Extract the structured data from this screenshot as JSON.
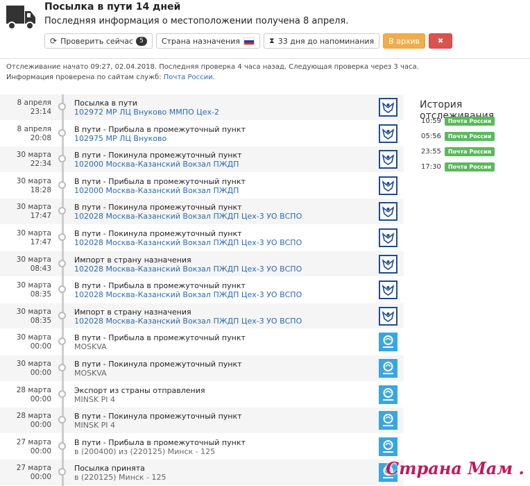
{
  "header": {
    "title": "Посылка в пути 14 дней",
    "subtitle": "Последняя информация о местоположении получена 8 апреля.",
    "buttons": {
      "check_now": "Проверить сейчас",
      "check_count": "5",
      "destination": "Страна назначения",
      "reminder": "33 дня до напоминания",
      "archive": "В архив",
      "delete": "✖"
    }
  },
  "info": {
    "line1": "Отслеживание начато 09:27, 02.04.2018. Последняя проверка 4 часа назад. Следующая проверка через 3 часа.",
    "line2_prefix": "Информация проверена по сайтам служб: ",
    "line2_link": "Почта России",
    "line2_suffix": "."
  },
  "events": [
    {
      "date": "8 апреля",
      "time": "23:14",
      "status": "Посылка в пути",
      "location": "102972 МР ЛЦ Внуково ММПО Цех-2",
      "service": "rp"
    },
    {
      "date": "8 апреля",
      "time": "20:08",
      "status": "В пути - Прибыла в промежуточный пункт",
      "location": "102975 МР ЛЦ Внуково",
      "service": "rp"
    },
    {
      "date": "30 марта",
      "time": "22:34",
      "status": "В пути - Покинула промежуточный пункт",
      "location": "102000 Москва-Казанский Вокзал ПЖДП",
      "service": "rp"
    },
    {
      "date": "30 марта",
      "time": "18:28",
      "status": "В пути - Прибыла в промежуточный пункт",
      "location": "102000 Москва-Казанский Вокзал ПЖДП",
      "service": "rp"
    },
    {
      "date": "30 марта",
      "time": "17:47",
      "status": "В пути - Покинула промежуточный пункт",
      "location": "102028 Москва-Казанский Вокзал ПЖДП Цех-3 УО ВСПО",
      "service": "rp"
    },
    {
      "date": "30 марта",
      "time": "17:47",
      "status": "В пути - Покинула промежуточный пункт",
      "location": "102028 Москва-Казанский Вокзал ПЖДП Цех-3 УО ВСПО",
      "service": "rp"
    },
    {
      "date": "30 марта",
      "time": "08:43",
      "status": "Импорт в страну назначения",
      "location": "102028 Москва-Казанский Вокзал ПЖДП Цех-3 УО ВСПО",
      "service": "rp"
    },
    {
      "date": "30 марта",
      "time": "08:35",
      "status": "В пути - Прибыла в промежуточный пункт",
      "location": "102028 Москва-Казанский Вокзал ПЖДП Цех-3 УО ВСПО",
      "service": "rp"
    },
    {
      "date": "30 марта",
      "time": "08:35",
      "status": "Импорт в страну назначения",
      "location": "102028 Москва-Казанский Вокзал ПЖДП Цех-3 УО ВСПО",
      "service": "rp"
    },
    {
      "date": "30 марта",
      "time": "00:00",
      "status": "В пути - Прибыла в промежуточный пункт",
      "location": "MOSKVA",
      "service": "bp"
    },
    {
      "date": "30 марта",
      "time": "00:00",
      "status": "В пути - Покинула промежуточный пункт",
      "location": "MOSKVA",
      "service": "bp"
    },
    {
      "date": "28 марта",
      "time": "00:00",
      "status": "Экспорт из страны отправления",
      "location": "MINSK PI 4",
      "service": "bp"
    },
    {
      "date": "28 марта",
      "time": "00:00",
      "status": "В пути - Покинула промежуточный пункт",
      "location": "MINSK PI 4",
      "service": "bp"
    },
    {
      "date": "27 марта",
      "time": "00:00",
      "status": "В пути - Прибыла в промежуточный пункт",
      "location": "в (200400) из (220125) Минск - 125",
      "service": "bp"
    },
    {
      "date": "27 марта",
      "time": "00:00",
      "status": "Посылка принята",
      "location": "в (220125) Минск - 125",
      "service": "bp"
    }
  ],
  "history": {
    "title": "История отслеживания",
    "items": [
      {
        "time": "10:59",
        "service": "Почта России"
      },
      {
        "time": "05:56",
        "service": "Почта России"
      },
      {
        "time": "23:55",
        "service": "Почта России"
      },
      {
        "time": "17:30",
        "service": "Почта России"
      }
    ]
  },
  "watermark": "Страна Мам . ру",
  "colors": {
    "link": "#2a6bb0",
    "archive": "#f0ad4e",
    "delete": "#d9534f",
    "tag": "#5cb85c"
  }
}
